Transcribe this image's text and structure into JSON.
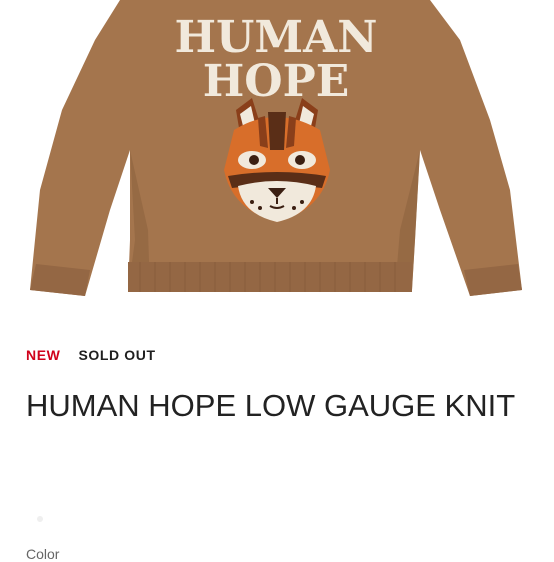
{
  "product": {
    "image_alt": "Brown low gauge knit sweater with HUMAN HOPE lettering and animal face",
    "knit_text_line1": "HUMAN",
    "knit_text_line2": "HOPE",
    "badges": {
      "new": "NEW",
      "sold_out": "SOLD OUT"
    },
    "title": "HUMAN HOPE LOW GAUGE KNIT",
    "color_label": "Color"
  },
  "colors": {
    "sweater": "#a4754d",
    "sweater_shade": "#8e6240",
    "knit_text": "#f1e9dc",
    "new_badge": "#d0021b",
    "title": "#222222"
  }
}
